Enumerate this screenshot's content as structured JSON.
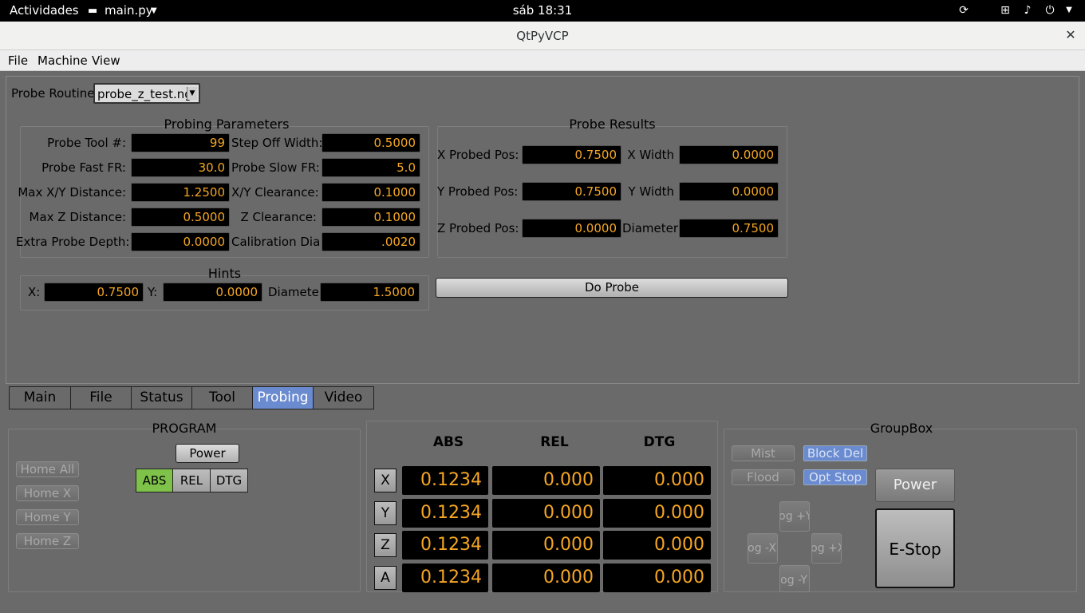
{
  "topbar": {
    "activities": "Actividades",
    "app_name": "main.py",
    "clock": "sáb 18:31"
  },
  "window": {
    "title": "QtPyVCP"
  },
  "menu": {
    "items": [
      "File",
      "Machine",
      "View"
    ]
  },
  "probe_routine": {
    "label": "Probe Routine:",
    "value": "probe_z_test.ng"
  },
  "probing_parameters": {
    "title": "Probing Parameters",
    "rows": [
      {
        "label": "Probe Tool #:",
        "value": "99",
        "label2": "Step Off Width:",
        "value2": "0.5000"
      },
      {
        "label": "Probe Fast FR:",
        "value": "30.0",
        "label2": "Probe Slow FR:",
        "value2": "5.0"
      },
      {
        "label": "Max X/Y Distance:",
        "value": "1.2500",
        "label2": "X/Y Clearance:",
        "value2": "0.1000"
      },
      {
        "label": "Max Z Distance:",
        "value": "0.5000",
        "label2": "Z Clearance:",
        "value2": "0.1000"
      },
      {
        "label": "Extra Probe Depth:",
        "value": "0.0000",
        "label2": "Calibration Dia:",
        "value2": ".0020"
      }
    ]
  },
  "probe_results": {
    "title": "Probe Results",
    "rows": [
      {
        "label": "X Probed Pos:",
        "value": "0.7500",
        "label2": "X Width",
        "value2": "0.0000"
      },
      {
        "label": "Y Probed Pos:",
        "value": "0.7500",
        "label2": "Y Width",
        "value2": "0.0000"
      },
      {
        "label": "Z Probed Pos:",
        "value": "0.0000",
        "label2": "Diameter",
        "value2": "0.7500"
      }
    ]
  },
  "hints": {
    "title": "Hints",
    "x_label": "X:",
    "x_value": "0.7500",
    "y_label": "Y:",
    "y_value": "0.0000",
    "d_label": "Diameter",
    "d_value": "1.5000"
  },
  "do_probe": {
    "label": "Do Probe"
  },
  "tabs": {
    "items": [
      "Main",
      "File",
      "Status",
      "Tool",
      "Probing",
      "Video"
    ],
    "active": "Probing"
  },
  "program": {
    "title": "PROGRAM",
    "home_buttons": [
      "Home All",
      "Home X",
      "Home Y",
      "Home Z"
    ],
    "power_label": "Power",
    "modes": [
      "ABS",
      "REL",
      "DTG"
    ],
    "active_mode": "ABS"
  },
  "dro": {
    "headers": [
      "ABS",
      "REL",
      "DTG"
    ],
    "axes": [
      {
        "axis": "X",
        "abs": "0.1234",
        "rel": "0.000",
        "dtg": "0.000"
      },
      {
        "axis": "Y",
        "abs": "0.1234",
        "rel": "0.000",
        "dtg": "0.000"
      },
      {
        "axis": "Z",
        "abs": "0.1234",
        "rel": "0.000",
        "dtg": "0.000"
      },
      {
        "axis": "A",
        "abs": "0.1234",
        "rel": "0.000",
        "dtg": "0.000"
      }
    ]
  },
  "groupbox": {
    "title": "GroupBox",
    "mist": "Mist",
    "flood": "Flood",
    "block_del": "Block Del",
    "opt_stop": "Opt Stop",
    "power": "Power",
    "estop": "E-Stop",
    "jog_up": "Jog +Y",
    "jog_down": "Jog -Y",
    "jog_left": "Jog -X",
    "jog_right": "Jog +X"
  },
  "colors": {
    "field_text": "#f5a623",
    "active_tab": "#6b8bd0",
    "active_mode": "#7ec24a"
  }
}
